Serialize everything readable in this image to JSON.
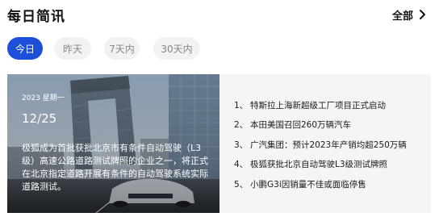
{
  "header": {
    "title": "每日简讯",
    "all_label": "全部"
  },
  "tabs": [
    "今日",
    "昨天",
    "7天内",
    "30天内"
  ],
  "feature": {
    "weekday": "2023  星期一",
    "date": "12/25",
    "text": "极狐成为首批获批北京市有条件自动驾驶（L3级）高速公路道路测试牌照的企业之一，将正式在北京指定道路开展有条件的自动驾驶系统实际道路测试。"
  },
  "news": [
    {
      "num": "1、",
      "text": "特斯拉上海新超级工厂项目正式启动"
    },
    {
      "num": "2、",
      "text": "本田美国召回260万辆汽车"
    },
    {
      "num": "3、",
      "text": "广汽集团：预计2023年产销均超250万辆"
    },
    {
      "num": "4、",
      "text": "极狐获批北京自动驾驶L3级测试牌照"
    },
    {
      "num": "5、",
      "text": "小鹏G3i因销量不佳或面临停售"
    }
  ],
  "colors": {
    "accent": "#1f4fd8",
    "tab_bg": "#f2f2f2",
    "panel_bg": "#f5f5f5"
  }
}
